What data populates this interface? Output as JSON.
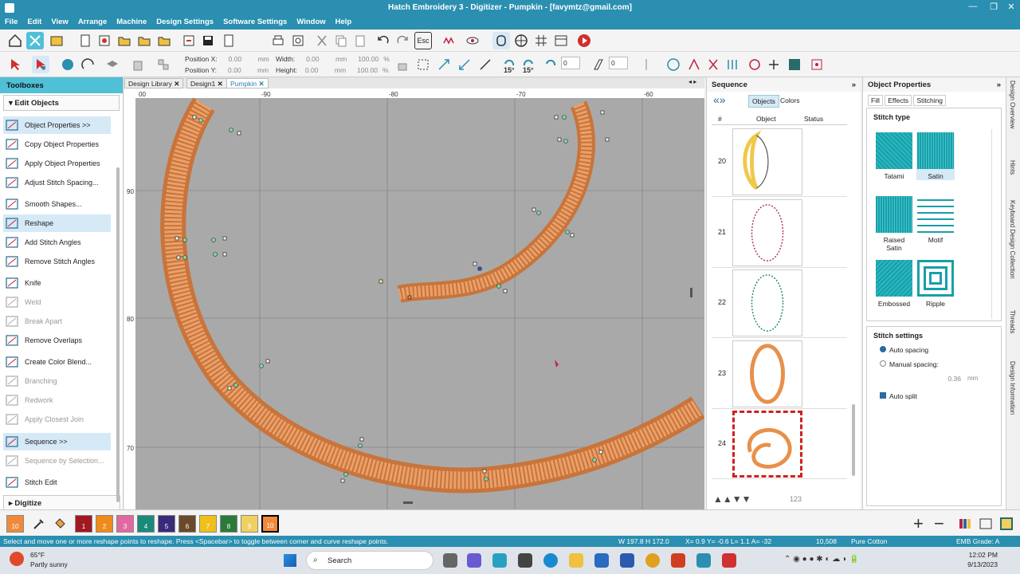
{
  "window": {
    "title": "Hatch Embroidery 3 - Digitizer - Pumpkin - [favymtz@gmail.com]"
  },
  "menu": [
    "File",
    "Edit",
    "View",
    "Arrange",
    "Machine",
    "Design Settings",
    "Software Settings",
    "Window",
    "Help"
  ],
  "toolbar2": {
    "pos_x_label": "Position X:",
    "pos_x_value": "0.00",
    "pos_x_unit": "mm",
    "pos_y_label": "Position Y:",
    "pos_y_value": "0.00",
    "pos_y_unit": "mm",
    "width_label": "Width:",
    "width_value": "0.00",
    "width_unit": "mm",
    "width_pct": "100.00",
    "width_pct_unit": "%",
    "height_label": "Height:",
    "height_value": "0.00",
    "height_unit": "mm",
    "height_pct": "100.00",
    "height_pct_unit": "%",
    "rotate_15a": "15°",
    "rotate_15b": "15°",
    "rotate_value": "0",
    "slant_value": "0",
    "esc": "Esc"
  },
  "toolboxes": {
    "title": "Toolboxes",
    "section_edit": "Edit Objects",
    "section_digitize": "Digitize",
    "items": [
      {
        "label": "Object Properties >>",
        "state": "selected"
      },
      {
        "label": "Copy Object Properties",
        "state": "normal"
      },
      {
        "label": "Apply Object Properties",
        "state": "normal"
      },
      {
        "label": "Adjust Stitch Spacing...",
        "state": "normal"
      },
      {
        "label": "Smooth Shapes...",
        "state": "normal"
      },
      {
        "label": "Reshape",
        "state": "selected"
      },
      {
        "label": "Add Stitch Angles",
        "state": "normal"
      },
      {
        "label": "Remove Stitch Angles",
        "state": "normal"
      },
      {
        "label": "Knife",
        "state": "normal"
      },
      {
        "label": "Weld",
        "state": "disabled"
      },
      {
        "label": "Break Apart",
        "state": "disabled"
      },
      {
        "label": "Remove Overlaps",
        "state": "normal"
      },
      {
        "label": "Create Color Blend...",
        "state": "normal"
      },
      {
        "label": "Branching",
        "state": "disabled"
      },
      {
        "label": "Redwork",
        "state": "disabled"
      },
      {
        "label": "Apply Closest Join",
        "state": "disabled"
      },
      {
        "label": "Sequence >>",
        "state": "selected"
      },
      {
        "label": "Sequence by Selection...",
        "state": "disabled"
      },
      {
        "label": "Stitch Edit",
        "state": "normal"
      }
    ]
  },
  "tabs": [
    {
      "label": "Design Library",
      "close": "✕"
    },
    {
      "label": "Design1",
      "close": "✕"
    },
    {
      "label": "Pumpkin",
      "close": "✕"
    }
  ],
  "ruler": {
    "top": [
      "00",
      "-90",
      "-80",
      "-70",
      "-60"
    ],
    "left": [
      "90",
      "80",
      "70"
    ]
  },
  "sequence": {
    "title": "Sequence",
    "tab_objects": "Objects",
    "tab_colors": "Colors",
    "col_num": "#",
    "col_object": "Object",
    "col_status": "Status",
    "rows": [
      {
        "num": "20",
        "shape": "crescent",
        "color": "#f0c84a"
      },
      {
        "num": "21",
        "shape": "oval-dots",
        "color": "#b0306a"
      },
      {
        "num": "22",
        "shape": "oval-dots",
        "color": "#1a8a7a"
      },
      {
        "num": "23",
        "shape": "oval-satin",
        "color": "#e8904a"
      },
      {
        "num": "24",
        "shape": "spiral",
        "color": "#e8904a"
      }
    ],
    "counter_label": "123"
  },
  "properties": {
    "title": "Object Properties",
    "tabs": [
      "Fill",
      "Effects",
      "Stitching"
    ],
    "stitch_type_title": "Stitch type",
    "stitch_types": [
      "Tatami",
      "Satin",
      "Raised Satin",
      "Motif",
      "Embossed",
      "Ripple"
    ],
    "stitch_settings_title": "Stitch settings",
    "auto_spacing": "Auto spacing",
    "manual_spacing": "Manual spacing:",
    "manual_value": "0.36",
    "manual_unit": "mm",
    "auto_split": "Auto split"
  },
  "side_tabs": [
    "Design Overview",
    "Hints",
    "Keyboard Design Collection",
    "Threads",
    "Design Information"
  ],
  "colors": {
    "current": "10",
    "chips": [
      {
        "label": "1",
        "color": "#a01822"
      },
      {
        "label": "2",
        "color": "#f08a1a"
      },
      {
        "label": "3",
        "color": "#e06aa0"
      },
      {
        "label": "4",
        "color": "#1a8a7a"
      },
      {
        "label": "5",
        "color": "#3a2a7a"
      },
      {
        "label": "6",
        "color": "#6a4a2a"
      },
      {
        "label": "7",
        "color": "#f0c01a"
      },
      {
        "label": "8",
        "color": "#2a7a3a"
      },
      {
        "label": "9",
        "color": "#f0d060"
      },
      {
        "label": "10",
        "color": "#f08a3a"
      }
    ]
  },
  "status": {
    "message": "Select and move one or more reshape points to reshape. Press <Spacebar> to toggle between corner and curve reshape points.",
    "dims": "W 197.8 H 172.0",
    "coords": "X=   0.9 Y=  -0.6 L=   1.1 A= -32",
    "stitches": "10,508",
    "fabric": "Pure Cotton",
    "grade": "EMB Grade: A"
  },
  "taskbar": {
    "weather_temp": "65°F",
    "weather_desc": "Partly sunny",
    "search": "Search",
    "time": "12:02 PM",
    "date": "9/13/2023"
  }
}
